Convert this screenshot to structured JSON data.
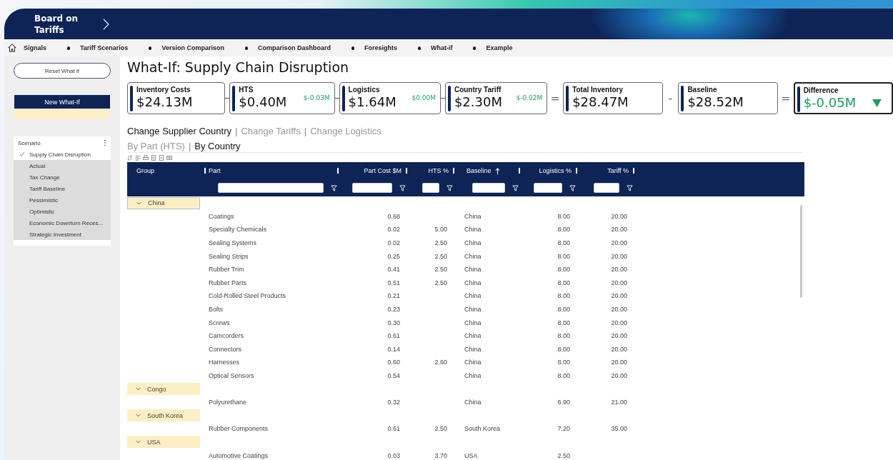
{
  "app": {
    "title": "Board on Tariffs"
  },
  "nav": [
    {
      "label": "Signals"
    },
    {
      "label": "Tariff Scenarios"
    },
    {
      "label": "Version Comparison"
    },
    {
      "label": "Comparison Dashboard"
    },
    {
      "label": "Foresights"
    },
    {
      "label": "What-if"
    },
    {
      "label": "Example"
    }
  ],
  "sidebar": {
    "reset_button": "Reset What if",
    "new_button": "New What-If",
    "scenario": {
      "title": "Scenario",
      "items": [
        {
          "label": "Supply Chain Disruption",
          "selected": true
        },
        {
          "label": "Actual",
          "selected": false
        },
        {
          "label": "Tax Change",
          "selected": false
        },
        {
          "label": "Tariff Baseline",
          "selected": false
        },
        {
          "label": "Pessimistic",
          "selected": false
        },
        {
          "label": "Optimistic",
          "selected": false
        },
        {
          "label": "Economic Downturn Reces...",
          "selected": false
        },
        {
          "label": "Strategic Investment",
          "selected": false
        }
      ]
    }
  },
  "page_title": "What-If: Supply Chain Disruption",
  "kpis": [
    {
      "kind": "card",
      "label": "Inventory Costs",
      "value": "$24.13M"
    },
    {
      "kind": "connector"
    },
    {
      "kind": "card",
      "label": "HTS",
      "value": "$0.40M",
      "delta": "$-0.03M"
    },
    {
      "kind": "connector"
    },
    {
      "kind": "card",
      "label": "Logistics",
      "value": "$1.64M",
      "delta": "$0.00M"
    },
    {
      "kind": "connector"
    },
    {
      "kind": "card",
      "label": "Country Tariff",
      "value": "$2.30M",
      "delta": "$-0.02M"
    },
    {
      "kind": "operator",
      "symbol": "="
    },
    {
      "kind": "card",
      "label": "Total Inventory",
      "value": "$28.47M"
    },
    {
      "kind": "operator",
      "symbol": "-"
    },
    {
      "kind": "card",
      "label": "Baseline",
      "value": "$28.52M"
    },
    {
      "kind": "operator",
      "symbol": "="
    },
    {
      "kind": "card",
      "label": "Difference",
      "value": "$-0.05M",
      "decrease": true
    }
  ],
  "change_tabs": {
    "separator": "|",
    "items": [
      {
        "label": "Change Supplier Country",
        "selected": true
      },
      {
        "label": "Change Tariffs",
        "selected": false
      },
      {
        "label": "Change Logistics",
        "selected": false
      }
    ]
  },
  "view_tabs": {
    "separator": "|",
    "items": [
      {
        "label": "By Part (HTS)",
        "selected": false
      },
      {
        "label": "By Country",
        "selected": true
      }
    ]
  },
  "table": {
    "columns": [
      {
        "label": "Group",
        "filter": false,
        "sorted": false
      },
      {
        "label": "Part",
        "filter": true,
        "sorted": false
      },
      {
        "label": "Part Cost $M",
        "filter": true,
        "sorted": false
      },
      {
        "label": "HTS %",
        "filter": true,
        "sorted": false
      },
      {
        "label": "Baseline",
        "filter": true,
        "sorted": true
      },
      {
        "label": "Logistics %",
        "filter": true,
        "sorted": false
      },
      {
        "label": "Tariff %",
        "filter": true,
        "sorted": false
      }
    ],
    "groups": [
      {
        "name": "China",
        "selected": true,
        "rows": [
          [
            "Coatings",
            "0.68",
            "",
            "China",
            "8.00",
            "20.00"
          ],
          [
            "Specialty Chemicals",
            "0.02",
            "5.00",
            "China",
            "8.00",
            "20.00"
          ],
          [
            "Sealing Systems",
            "0.02",
            "2.50",
            "China",
            "8.00",
            "20.00"
          ],
          [
            "Sealing Strips",
            "0.25",
            "2.50",
            "China",
            "8.00",
            "20.00"
          ],
          [
            "Rubber Trim",
            "0.41",
            "2.50",
            "China",
            "8.00",
            "20.00"
          ],
          [
            "Rubber Parts",
            "0.51",
            "2.50",
            "China",
            "8.00",
            "20.00"
          ],
          [
            "Cold-Rolled Steel Products",
            "0.21",
            "",
            "China",
            "8.00",
            "20.00"
          ],
          [
            "Bolts",
            "0.23",
            "",
            "China",
            "8.00",
            "20.00"
          ],
          [
            "Screws",
            "0.30",
            "",
            "China",
            "8.00",
            "20.00"
          ],
          [
            "Camcorders",
            "0.61",
            "",
            "China",
            "8.00",
            "20.00"
          ],
          [
            "Connectors",
            "0.14",
            "",
            "China",
            "8.00",
            "20.00"
          ],
          [
            "Harnesses",
            "0.60",
            "2.60",
            "China",
            "8.00",
            "20.00"
          ],
          [
            "Optical Sensors",
            "0.54",
            "",
            "China",
            "8.00",
            "20.00"
          ]
        ]
      },
      {
        "name": "Congo",
        "selected": false,
        "rows": [
          [
            "Polyurethane",
            "0.32",
            "",
            "China",
            "6.90",
            "21.00"
          ]
        ]
      },
      {
        "name": "South Korea",
        "selected": false,
        "rows": [
          [
            "Rubber Components",
            "0.61",
            "2.50",
            "South Korea",
            "7.20",
            "35.00"
          ]
        ]
      },
      {
        "name": "USA",
        "selected": false,
        "rows": [
          [
            "Automotive Coatings",
            "0.03",
            "3.70",
            "USA",
            "2.50",
            ""
          ]
        ]
      }
    ]
  }
}
